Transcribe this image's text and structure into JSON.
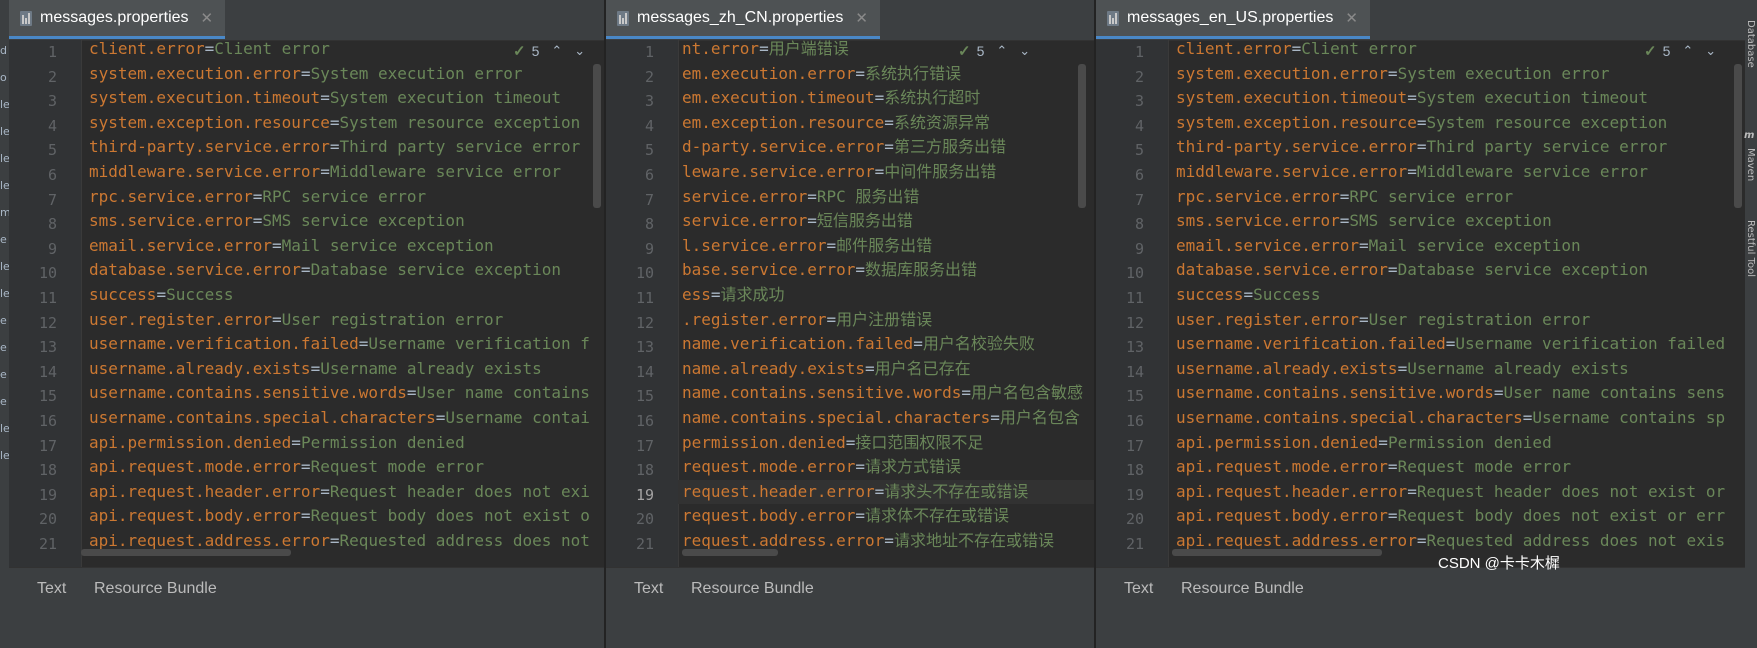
{
  "left_strip_chars": [
    "d",
    "o",
    "le",
    "le",
    "le",
    "le",
    "m",
    "e",
    "le",
    "le",
    "e",
    "e",
    "e",
    "e",
    "le",
    "le"
  ],
  "right_tools": [
    "Database",
    "Maven",
    "Restful Tool"
  ],
  "right_maven_letter": "m",
  "panes": [
    {
      "tab_title": "messages.properties",
      "inspection_count": "5",
      "lines": [
        [
          "client.error",
          "Client error"
        ],
        [
          "system.execution.error",
          "System execution error"
        ],
        [
          "system.execution.timeout",
          "System execution timeout"
        ],
        [
          "system.exception.resource",
          "System resource exception"
        ],
        [
          "third-party.service.error",
          "Third party service error"
        ],
        [
          "middleware.service.error",
          "Middleware service error"
        ],
        [
          "rpc.service.error",
          "RPC service error"
        ],
        [
          "sms.service.error",
          "SMS service exception"
        ],
        [
          "email.service.error",
          "Mail service exception"
        ],
        [
          "database.service.error",
          "Database service exception"
        ],
        [
          "success",
          "Success"
        ],
        [
          "user.register.error",
          "User registration error"
        ],
        [
          "username.verification.failed",
          "Username verification f"
        ],
        [
          "username.already.exists",
          "Username already exists"
        ],
        [
          "username.contains.sensitive.words",
          "User name contains"
        ],
        [
          "username.contains.special.characters",
          "Username contai"
        ],
        [
          "api.permission.denied",
          "Permission denied"
        ],
        [
          "api.request.mode.error",
          "Request mode error"
        ],
        [
          "api.request.header.error",
          "Request header does not exi"
        ],
        [
          "api.request.body.error",
          "Request body does not exist o"
        ],
        [
          "api.request.address.error",
          "Requested address does not"
        ]
      ],
      "bottom_tabs": [
        "Text",
        "Resource Bundle"
      ]
    },
    {
      "tab_title": "messages_zh_CN.properties",
      "inspection_count": "5",
      "lines": [
        [
          "nt.error",
          "用户端错误"
        ],
        [
          "em.execution.error",
          "系统执行错误"
        ],
        [
          "em.execution.timeout",
          "系统执行超时"
        ],
        [
          "em.exception.resource",
          "系统资源异常"
        ],
        [
          "d-party.service.error",
          "第三方服务出错"
        ],
        [
          "leware.service.error",
          "中间件服务出错"
        ],
        [
          "service.error",
          "RPC 服务出错"
        ],
        [
          "service.error",
          "短信服务出错"
        ],
        [
          "l.service.error",
          "邮件服务出错"
        ],
        [
          "base.service.error",
          "数据库服务出错"
        ],
        [
          "ess",
          "请求成功"
        ],
        [
          ".register.error",
          "用户注册错误"
        ],
        [
          "name.verification.failed",
          "用户名校验失败"
        ],
        [
          "name.already.exists",
          "用户名已存在"
        ],
        [
          "name.contains.sensitive.words",
          "用户名包含敏感"
        ],
        [
          "name.contains.special.characters",
          "用户名包含"
        ],
        [
          "permission.denied",
          "接口范围权限不足"
        ],
        [
          "request.mode.error",
          "请求方式错误"
        ],
        [
          "request.header.error",
          "请求头不存在或错误"
        ],
        [
          "request.body.error",
          "请求体不存在或错误"
        ],
        [
          "request.address.error",
          "请求地址不存在或错误"
        ]
      ],
      "bottom_tabs": [
        "Text",
        "Resource Bundle"
      ]
    },
    {
      "tab_title": "messages_en_US.properties",
      "inspection_count": "5",
      "lines": [
        [
          "client.error",
          "Client error"
        ],
        [
          "system.execution.error",
          "System execution error"
        ],
        [
          "system.execution.timeout",
          "System execution timeout"
        ],
        [
          "system.exception.resource",
          "System resource exception"
        ],
        [
          "third-party.service.error",
          "Third party service error"
        ],
        [
          "middleware.service.error",
          "Middleware service error"
        ],
        [
          "rpc.service.error",
          "RPC service error"
        ],
        [
          "sms.service.error",
          "SMS service exception"
        ],
        [
          "email.service.error",
          "Mail service exception"
        ],
        [
          "database.service.error",
          "Database service exception"
        ],
        [
          "success",
          "Success"
        ],
        [
          "user.register.error",
          "User registration error"
        ],
        [
          "username.verification.failed",
          "Username verification failed"
        ],
        [
          "username.already.exists",
          "Username already exists"
        ],
        [
          "username.contains.sensitive.words",
          "User name contains sens"
        ],
        [
          "username.contains.special.characters",
          "Username contains sp"
        ],
        [
          "api.permission.denied",
          "Permission denied"
        ],
        [
          "api.request.mode.error",
          "Request mode error"
        ],
        [
          "api.request.header.error",
          "Request header does not exist or"
        ],
        [
          "api.request.body.error",
          "Request body does not exist or err"
        ],
        [
          "api.request.address.error",
          "Requested address does not exis"
        ]
      ],
      "bottom_tabs": [
        "Text",
        "Resource Bundle"
      ]
    }
  ],
  "watermark": "CSDN @卡卡木樨"
}
